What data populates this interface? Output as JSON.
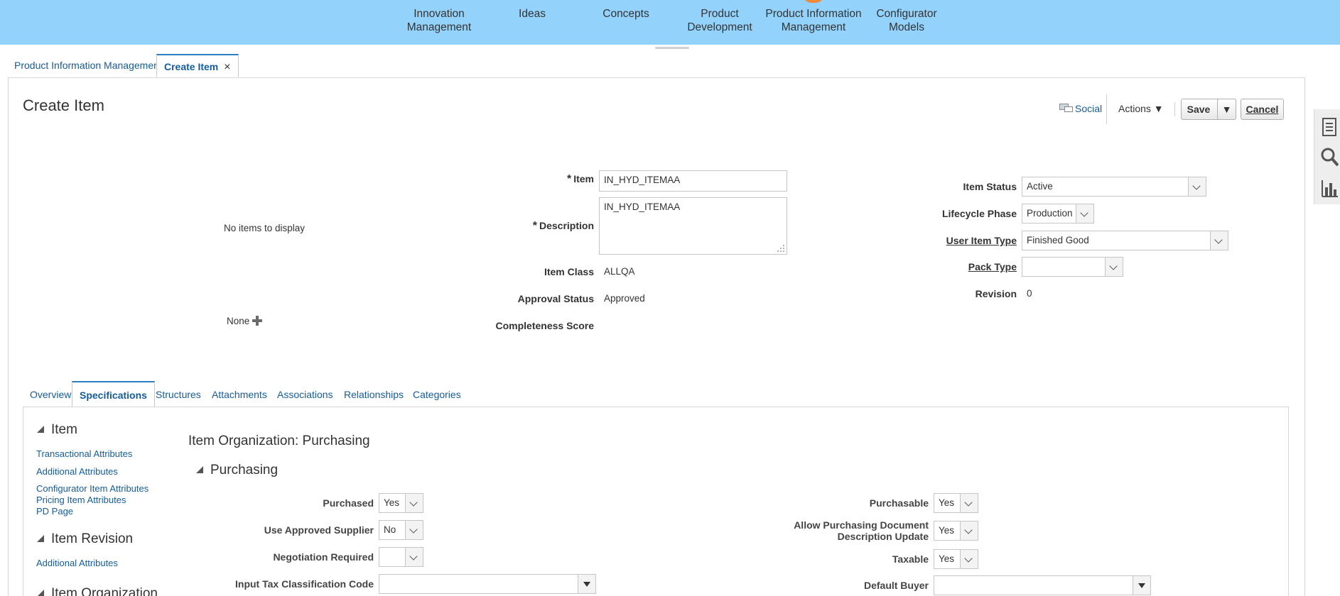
{
  "nav": {
    "items": [
      "Innovation\nManagement",
      "Ideas",
      "Concepts",
      "Product\nDevelopment",
      "Product Information\nManagement",
      "Configurator\nModels"
    ]
  },
  "page_tabs": {
    "pim": "Product Information Management",
    "create_item": "Create Item",
    "close": "×"
  },
  "header": {
    "title": "Create Item",
    "social": "Social",
    "actions": "Actions ▼",
    "save": "Save",
    "save_menu": "▼",
    "cancel": "Cancel"
  },
  "image_area": {
    "no_items": "No items to display",
    "none": "None"
  },
  "form": {
    "item_label": "Item",
    "item_value": "IN_HYD_ITEMAA",
    "description_label": "Description",
    "description_value": "IN_HYD_ITEMAA",
    "item_class_label": "Item Class",
    "item_class_value": "ALLQA",
    "approval_status_label": "Approval Status",
    "approval_status_value": "Approved",
    "completeness_label": "Completeness Score",
    "item_status_label": "Item Status",
    "item_status_value": "Active",
    "lifecycle_label": "Lifecycle Phase",
    "lifecycle_value": "Production",
    "user_item_type_label": "User Item Type",
    "user_item_type_value": "Finished Good",
    "pack_type_label": "Pack Type",
    "pack_type_value": "",
    "revision_label": "Revision",
    "revision_value": "0"
  },
  "subtabs": [
    "Overview",
    "Specifications",
    "Structures",
    "Attachments",
    "Associations",
    "Relationships",
    "Categories"
  ],
  "left_nav": {
    "item_section": "Item",
    "item_links": [
      "Transactional Attributes",
      "Additional Attributes",
      "Configurator Item Attributes",
      "Pricing Item Attributes",
      "PD Page"
    ],
    "revision_section": "Item Revision",
    "revision_links": [
      "Additional Attributes"
    ],
    "org_section": "Item Organization"
  },
  "purchasing": {
    "heading": "Item Organization: Purchasing",
    "section": "Purchasing",
    "purchased_label": "Purchased",
    "purchased_value": "Yes",
    "use_approved_label": "Use Approved Supplier",
    "use_approved_value": "No",
    "negotiation_label": "Negotiation Required",
    "negotiation_value": "",
    "input_tax_label": "Input Tax Classification Code",
    "input_tax_value": "",
    "purchasable_label": "Purchasable",
    "purchasable_value": "Yes",
    "allow_update_label": "Allow Purchasing Document Description Update",
    "allow_update_value": "Yes",
    "taxable_label": "Taxable",
    "taxable_value": "Yes",
    "default_buyer_label": "Default Buyer",
    "default_buyer_value": ""
  }
}
